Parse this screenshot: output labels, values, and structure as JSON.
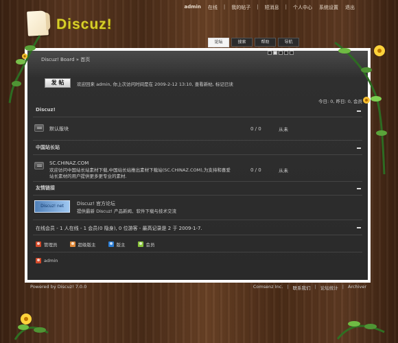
{
  "header": {
    "logo_text": "Discuz!",
    "top_links": [
      "admin",
      "在线",
      "|",
      "我的帖子",
      "|",
      "短消息",
      "|",
      "个人中心",
      "系统设置",
      "退出"
    ]
  },
  "tabs": [
    {
      "label": "论坛",
      "active": true
    },
    {
      "label": "搜索",
      "active": false
    },
    {
      "label": "帮助",
      "active": false
    },
    {
      "label": "导航",
      "active": false
    }
  ],
  "pager": {
    "count": 5,
    "active_index": 1
  },
  "breadcrumb": "Discuz! Board » 首页",
  "post_button": "发 帖",
  "welcome": "欢迎回来 admin, 你上次访问时间是在 2009-2-12 13:10, 查看新帖, 标记已读",
  "stats": "今日: 0, 昨日: 0, 会员",
  "sections": [
    {
      "title": "Discuz!",
      "forums": [
        {
          "name": "默认版块",
          "counts": "0 / 0",
          "last": "从未"
        }
      ]
    },
    {
      "title": "中国站长站",
      "forums": [
        {
          "name": "SC.CHINAZ.COM",
          "desc": "欢迎访问中国站长站素材下载,中国站长站推出素材下载站(SC.CHINAZ.COM),为支持和喜爱站长素材的用户提供更多更专业的素材.",
          "counts": "0 / 0",
          "last": "从未"
        }
      ]
    }
  ],
  "friend_links": {
    "title": "友情链接",
    "logo_text": "Discuz! net",
    "name": "Discuz! 官方论坛",
    "desc": "提供最新 Discuz! 产品新闻、软件下载与技术交流"
  },
  "online": "在线会员 - 1 人在线 - 1 会员(0 隐身), 0 位游客 - 最高记录是 2 于 2009-1-7.",
  "legend": [
    {
      "label": "管理员",
      "color": "#d44a2a"
    },
    {
      "label": "超级版主",
      "color": "#e08a3a"
    },
    {
      "label": "版主",
      "color": "#2d7fd6"
    },
    {
      "label": "会员",
      "color": "#89c43b"
    }
  ],
  "online_user": {
    "name": "admin",
    "color": "#d44a2a"
  },
  "footer": {
    "left": "Powered by Discuz! 7.0.0",
    "right": [
      "Comsenz Inc.",
      "|",
      "联系我们",
      "|",
      "论坛统计",
      "|",
      "Archiver"
    ]
  }
}
